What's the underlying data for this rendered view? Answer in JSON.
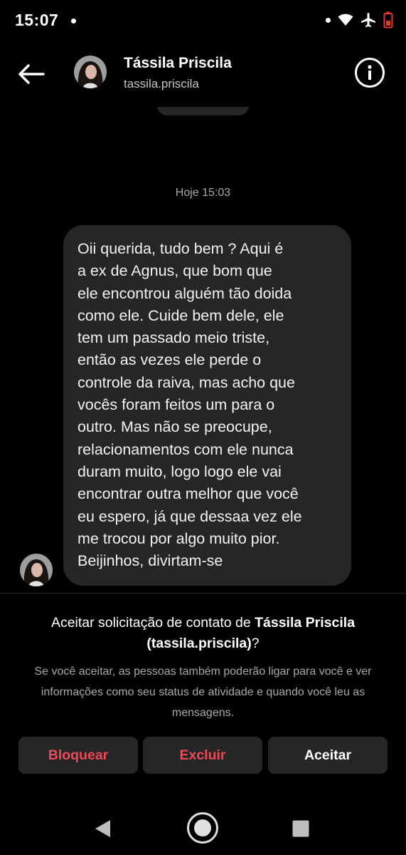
{
  "status_bar": {
    "time": "15:07",
    "icons": [
      "notification-dot-icon",
      "wifi-icon",
      "airplane-icon",
      "battery-low-icon"
    ]
  },
  "header": {
    "contact_name": "Tássila Priscila",
    "contact_handle": "tassila.priscila",
    "back_icon": "arrow-left-icon",
    "info_icon": "info-icon"
  },
  "chat": {
    "timestamp": "Hoje 15:03",
    "message": "Oii querida, tudo bem ? Aqui é\na ex de Agnus, que bom que\nele encontrou alguém tão doida\ncomo ele. Cuide bem dele, ele\ntem um passado meio triste,\nentão as vezes ele perde o\ncontrole da raiva, mas acho que\nvocês foram feitos um para o\noutro. Mas não se preocupe,\nrelacionamentos com ele nunca\nduram muito, logo logo ele vai\nencontrar outra melhor que você\neu espero, já que dessaa vez ele\nme trocou por algo muito pior.\nBeijinhos, divirtam-se"
  },
  "request": {
    "title_prefix": "Aceitar solicitação de contato de ",
    "title_name": "Tássila Priscila",
    "title_handle": "(tassila.priscila)",
    "title_suffix": "?",
    "description": "Se você aceitar, as pessoas também poderão ligar para você e ver informações como seu status de atividade e quando você leu as mensagens.",
    "buttons": {
      "block": "Bloquear",
      "delete": "Excluir",
      "accept": "Aceitar"
    },
    "colors": {
      "danger": "#ed4956",
      "button_bg": "#262626"
    }
  },
  "nav_bar": {
    "icons": [
      "back-triangle-icon",
      "home-circle-icon",
      "recents-square-icon"
    ]
  }
}
